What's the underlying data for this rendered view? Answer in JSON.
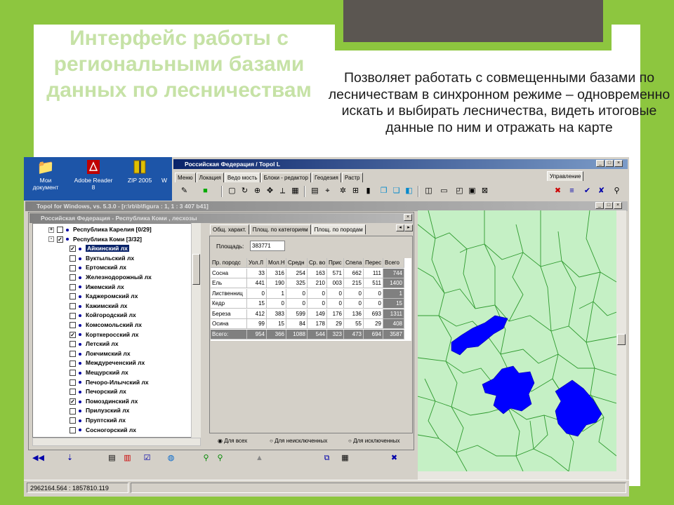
{
  "slide": {
    "title": "Интерфейс работы с региональными базами данных по лесничествам",
    "subtitle": "Позволяет работать с совмещенными базами по лесничествам в синхронном режиме – одновременно искать и выбирать лесничества, видеть итоговые данные по ним и отражать на карте"
  },
  "desktop": {
    "icons": [
      {
        "label": "Мои\nдокумент",
        "icon": "folder-icon"
      },
      {
        "label": "Adobe Reader\n8",
        "icon": "pdf-icon"
      },
      {
        "label": "ZIP 2005",
        "icon": "zip-icon"
      },
      {
        "label": "W",
        "icon": "app-icon"
      }
    ]
  },
  "main_window": {
    "title": "Российская Федерация / Topol L",
    "tabs": [
      "Меню",
      "Локация",
      "Ведо мость",
      "Блоки - редактор",
      "Геодезия",
      "Растр"
    ],
    "active_tab": "Ведо мость",
    "right_tab": "Управление"
  },
  "map_window": {
    "title": "Topol for Windows, vs. 5.3.0 - [r:\\rb\\b\\figura : 1, 1 : 3 407 b41]"
  },
  "db_window": {
    "title": "Российская Федерация - Республика Коми , лесхозы",
    "tree": [
      {
        "label": "Республика Карелия [0/29]",
        "level": 0,
        "expand": "+",
        "checked": false
      },
      {
        "label": "Республика Коми [3/32]",
        "level": 0,
        "expand": "-",
        "checked": true
      },
      {
        "label": "Айкинский лх",
        "level": 1,
        "checked": true,
        "selected": true
      },
      {
        "label": "Вуктыльский лх",
        "level": 1,
        "checked": false
      },
      {
        "label": "Ертомский лх",
        "level": 1,
        "checked": false
      },
      {
        "label": "Железнодорожный лх",
        "level": 1,
        "checked": false
      },
      {
        "label": "Ижемский лх",
        "level": 1,
        "checked": false
      },
      {
        "label": "Каджеромский лх",
        "level": 1,
        "checked": false
      },
      {
        "label": "Кажимский лх",
        "level": 1,
        "checked": false
      },
      {
        "label": "Койгородский лх",
        "level": 1,
        "checked": false
      },
      {
        "label": "Комсомольский лх",
        "level": 1,
        "checked": false
      },
      {
        "label": "Корткеросский лх",
        "level": 1,
        "checked": true
      },
      {
        "label": "Летский лх",
        "level": 1,
        "checked": false
      },
      {
        "label": "Локчимский лх",
        "level": 1,
        "checked": false
      },
      {
        "label": "Междуреченский лх",
        "level": 1,
        "checked": false
      },
      {
        "label": "Мещурский лх",
        "level": 1,
        "checked": false
      },
      {
        "label": "Печоро-Илычский лх",
        "level": 1,
        "checked": false
      },
      {
        "label": "Печорский лх",
        "level": 1,
        "checked": false
      },
      {
        "label": "Помоздинский лх",
        "level": 1,
        "checked": true
      },
      {
        "label": "Прилузский лх",
        "level": 1,
        "checked": false
      },
      {
        "label": "Пруптский лх",
        "level": 1,
        "checked": false
      },
      {
        "label": "Сосногорский лх",
        "level": 1,
        "checked": false
      }
    ],
    "detail_tabs": [
      "Общ. характ.",
      "Площ. по категориям",
      "Площ. по породам"
    ],
    "active_detail_tab": "Площ. по породам",
    "area_label": "Площадь:",
    "area_value": "383771",
    "table": {
      "columns": [
        "Пр. породс",
        "Уол.Л",
        "Мол.Н",
        "Средн",
        "Ср. во",
        "Прис",
        "Спела",
        "Перес",
        "Всего"
      ],
      "rows": [
        [
          "Сосна",
          "33",
          "316",
          "254",
          "163",
          "571",
          "662",
          "111",
          "744"
        ],
        [
          "Ель",
          "441",
          "190",
          "325",
          "210",
          "003",
          "215",
          "511",
          "1400"
        ],
        [
          "Лиственниц",
          "0",
          "1",
          "0",
          "0",
          "0",
          "0",
          "0",
          "1"
        ],
        [
          "Кедр",
          "15",
          "0",
          "0",
          "0",
          "0",
          "0",
          "0",
          "15"
        ],
        [
          "Береза",
          "412",
          "383",
          "599",
          "149",
          "176",
          "136",
          "693",
          "1311"
        ],
        [
          "Осина",
          "99",
          "15",
          "84",
          "178",
          "29",
          "55",
          "29",
          "408"
        ],
        [
          "Всего:",
          "954",
          "366",
          "1088",
          "544",
          "323",
          "473",
          "694",
          "3587"
        ]
      ]
    },
    "radio_options": [
      "Для всех",
      "Для неисключенных",
      "Для исключенных"
    ],
    "radio_selected": 0
  },
  "status": {
    "coords": "2962164.564 : 1857810.119"
  },
  "colors": {
    "slide_bg": "#8dc63f",
    "title_color": "#c6e2a6",
    "map_bg": "#c5f0c5",
    "map_lines": "#2f9a2f",
    "selected_polygons": "#0000ff"
  }
}
